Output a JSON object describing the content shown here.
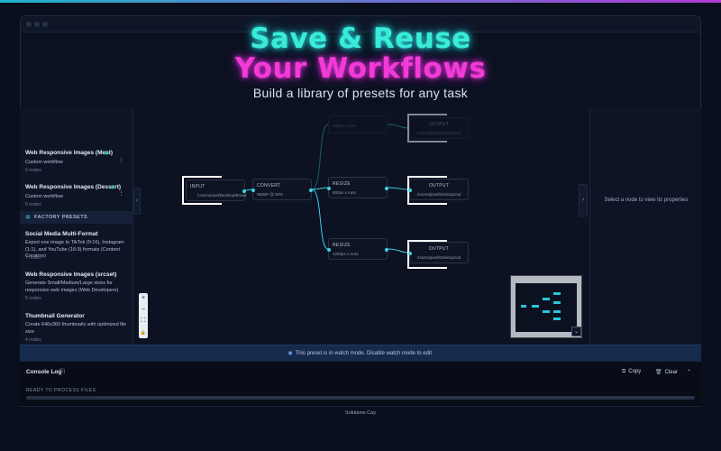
{
  "hero": {
    "line1": "Save & Reuse",
    "line2": "Your Workflows",
    "subtitle": "Build a library of presets for any task"
  },
  "colors": {
    "accent_cyan": "#39ecd8",
    "accent_magenta": "#f23bd6",
    "watch_bar": "#152a4d"
  },
  "sidebar": {
    "user_presets": [
      {
        "title": "Web Responsive Images (Meat)",
        "desc": "Custom workflow",
        "nodes": "6 nodes"
      },
      {
        "title": "Web Responsive Images (Dessert)",
        "desc": "Custom workflow",
        "nodes": "6 nodes"
      }
    ],
    "factory_header": "FACTORY PRESETS",
    "factory_presets": [
      {
        "title": "Social Media Multi-Format",
        "desc": "Export one image to TikTok (9:16), Instagram (1:1), and YouTube (16:9) formats (Content Creators)",
        "nodes": "7 nodes"
      },
      {
        "title": "Web Responsive Images (srcset)",
        "desc": "Generate Small/Medium/Large sizes for responsive web images (Web Developers)",
        "nodes": "8 nodes"
      },
      {
        "title": "Thumbnail Generator",
        "desc": "Create 640x360 thumbnails with optimized file size",
        "nodes": "4 nodes"
      }
    ]
  },
  "canvas": {
    "input": {
      "title": "INPUT",
      "sub": "/Users/pixel/Desktop/Bread"
    },
    "convert": {
      "title": "CONVERT",
      "sub": "WEBP @ 80%"
    },
    "resize1": {
      "title": "RESIZE",
      "sub": "800px x Auto"
    },
    "resize2": {
      "title": "RESIZE",
      "sub": "1200px x Auto"
    },
    "output1": {
      "title": "OUTPUT",
      "sub": "/Users/pixel/Desktop/out"
    },
    "output2": {
      "title": "OUTPUT",
      "sub": "/Users/pixel/Desktop/out"
    },
    "zoom": {
      "plus": "+",
      "minus": "−",
      "fit": "⛶",
      "lock": "🔒"
    }
  },
  "properties": {
    "empty_message": "Select a node to view its properties"
  },
  "watch_bar": {
    "message": "This preset is in watch mode. Disable watch mode to edit."
  },
  "console": {
    "title": "Console Log",
    "count": "(0)",
    "copy": "Copy",
    "clear": "Clear",
    "status": "READY TO PROCESS FILES"
  },
  "footer": {
    "text": "Solutions Cay"
  }
}
